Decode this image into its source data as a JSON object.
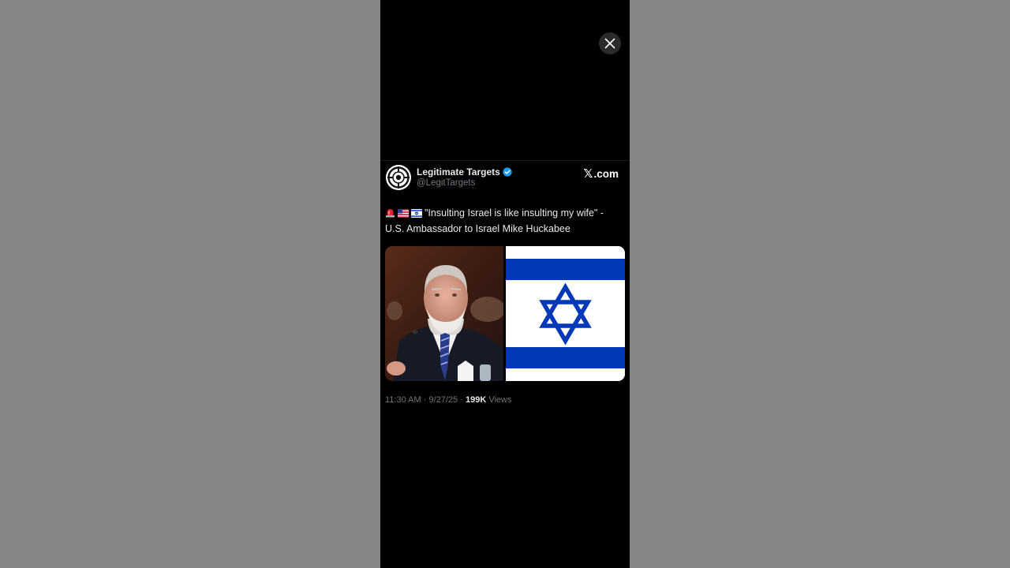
{
  "viewer": {
    "close_label": "Close"
  },
  "tweet": {
    "display_name": "Legitimate Targets",
    "handle": "@LegitTargets",
    "verified": true,
    "source_brand_mark": "𝕏",
    "source_brand_text": ".com",
    "emojis": [
      "siren-icon",
      "us-flag-icon",
      "israel-flag-icon"
    ],
    "text": "\"Insulting Israel is like insulting my wife\" - U.S. Ambassador to Israel Mike Huckabee",
    "time": "11:30 AM",
    "date": "9/27/25",
    "views_count": "199K",
    "views_label": "Views"
  },
  "colors": {
    "page_background": "#858585",
    "viewer_background": "#000000",
    "verified_badge": "#1d9bf0",
    "flag_blue": "#0038b8",
    "text_primary": "#e7e9ea",
    "text_secondary": "#71767b"
  }
}
